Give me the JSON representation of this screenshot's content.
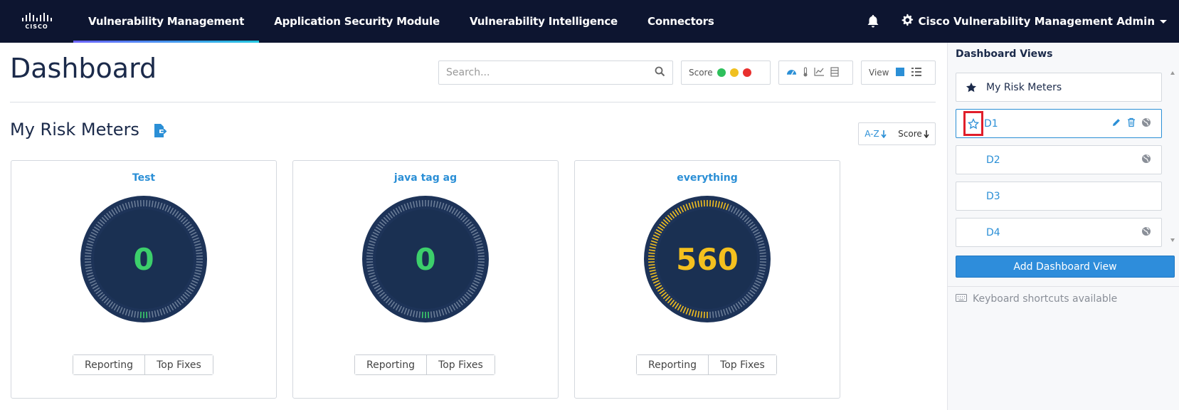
{
  "nav": {
    "logo_text": "CISCO",
    "items": [
      {
        "label": "Vulnerability Management",
        "active": true
      },
      {
        "label": "Application Security Module",
        "active": false
      },
      {
        "label": "Vulnerability Intelligence",
        "active": false
      },
      {
        "label": "Connectors",
        "active": false
      }
    ],
    "bell_icon": "bell-icon",
    "user_label": "Cisco Vulnerability Management Admin",
    "settings_icon": "gear-icon"
  },
  "header": {
    "title": "Dashboard",
    "search_placeholder": "Search...",
    "score_label": "Score",
    "score_colors": [
      "#2ec05c",
      "#f0c020",
      "#e8302e"
    ],
    "view_label": "View"
  },
  "section": {
    "title": "My Risk Meters",
    "sort_az": "A-Z",
    "sort_score": "Score"
  },
  "cards": [
    {
      "title": "Test",
      "score": "0",
      "color": "#3ccf6b",
      "arc_fraction": 0.0,
      "buttons": [
        "Reporting",
        "Top Fixes"
      ]
    },
    {
      "title": "java tag ag",
      "score": "0",
      "color": "#3ccf6b",
      "arc_fraction": 0.0,
      "buttons": [
        "Reporting",
        "Top Fixes"
      ]
    },
    {
      "title": "everything",
      "score": "560",
      "color": "#f4c01e",
      "arc_fraction": 0.56,
      "buttons": [
        "Reporting",
        "Top Fixes"
      ]
    }
  ],
  "side": {
    "title": "Dashboard Views",
    "views": [
      {
        "label": "My Risk Meters",
        "starred": true
      },
      {
        "label": "D1",
        "selected": true,
        "edit": true,
        "delete": true,
        "globe": true
      },
      {
        "label": "D2",
        "globe": true
      },
      {
        "label": "D3",
        "globe": false
      },
      {
        "label": "D4",
        "globe": true
      }
    ],
    "add_button": "Add Dashboard View",
    "shortcuts": "Keyboard shortcuts available"
  }
}
